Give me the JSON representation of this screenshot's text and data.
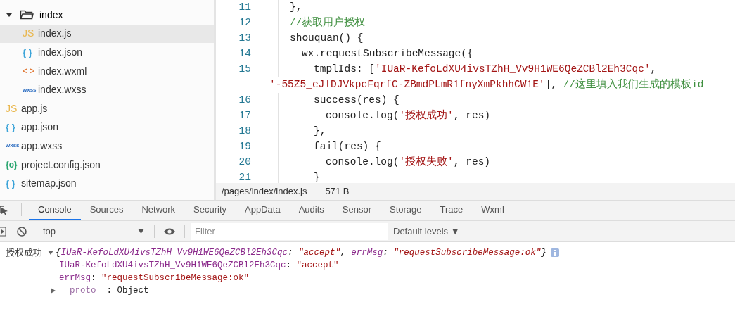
{
  "file_tree": [
    {
      "name": "index",
      "kind": "folder",
      "expanded": true,
      "selected": false,
      "children": [
        {
          "name": "index.js",
          "kind": "js",
          "icon": "JS",
          "selected": true
        },
        {
          "name": "index.json",
          "kind": "json",
          "icon": "{ }",
          "selected": false
        },
        {
          "name": "index.wxml",
          "kind": "wxml",
          "icon": "< >",
          "selected": false
        },
        {
          "name": "index.wxss",
          "kind": "wxss",
          "icon": "wxss",
          "selected": false
        }
      ]
    },
    {
      "name": "app.js",
      "kind": "js",
      "icon": "JS",
      "selected": false
    },
    {
      "name": "app.json",
      "kind": "json",
      "icon": "{ }",
      "selected": false
    },
    {
      "name": "app.wxss",
      "kind": "wxss",
      "icon": "wxss",
      "selected": false
    },
    {
      "name": "project.config.json",
      "kind": "config",
      "icon": "{o}",
      "selected": false
    },
    {
      "name": "sitemap.json",
      "kind": "json",
      "icon": "{ }",
      "selected": false
    }
  ],
  "editor": {
    "lines": [
      {
        "number": "11",
        "segments": [
          {
            "kind": "plain",
            "text": "    },"
          }
        ]
      },
      {
        "number": "12",
        "segments": [
          {
            "kind": "comment",
            "text": "    //获取用户授权"
          }
        ]
      },
      {
        "number": "13",
        "segments": [
          {
            "kind": "plain",
            "text": "    shouquan() {"
          }
        ]
      },
      {
        "number": "14",
        "segments": [
          {
            "kind": "plain",
            "text": "      wx.requestSubscribeMessage({"
          }
        ]
      },
      {
        "number": "15",
        "segments": [
          {
            "kind": "plain",
            "text": "        tmplIds: ["
          },
          {
            "kind": "string",
            "text": "'IUaR-KefoLdXU4ivsTZhH_Vv9H1WE6QeZCBl2Eh3Cqc'"
          },
          {
            "kind": "plain",
            "text": ","
          }
        ]
      },
      {
        "segments": [
          {
            "kind": "string",
            "text": "'-55Z5_eJlDJVkpcFqrfC-ZBmdPLmR1fnyXmPkhhCW1E'"
          },
          {
            "kind": "plain",
            "text": "], "
          },
          {
            "kind": "comment",
            "text": "//这里填入我们生成的模板id"
          }
        ]
      },
      {
        "number": "16",
        "segments": [
          {
            "kind": "plain",
            "text": "        success(res) {"
          }
        ]
      },
      {
        "number": "17",
        "segments": [
          {
            "kind": "plain",
            "text": "          console.log("
          },
          {
            "kind": "string",
            "text": "'授权成功'"
          },
          {
            "kind": "plain",
            "text": ", res)"
          }
        ]
      },
      {
        "number": "18",
        "segments": [
          {
            "kind": "plain",
            "text": "        },"
          }
        ]
      },
      {
        "number": "19",
        "segments": [
          {
            "kind": "plain",
            "text": "        fail(res) {"
          }
        ]
      },
      {
        "number": "20",
        "segments": [
          {
            "kind": "plain",
            "text": "          console.log("
          },
          {
            "kind": "string",
            "text": "'授权失败'"
          },
          {
            "kind": "plain",
            "text": ", res)"
          }
        ]
      },
      {
        "number": "21",
        "segments": [
          {
            "kind": "plain",
            "text": "        }"
          }
        ]
      }
    ],
    "status_bar": {
      "path": "/pages/index/index.js",
      "size": "571 B"
    }
  },
  "devtools": {
    "tabs": [
      {
        "label": "Console",
        "selected": true
      },
      {
        "label": "Sources",
        "selected": false
      },
      {
        "label": "Network",
        "selected": false
      },
      {
        "label": "Security",
        "selected": false
      },
      {
        "label": "AppData",
        "selected": false
      },
      {
        "label": "Audits",
        "selected": false
      },
      {
        "label": "Sensor",
        "selected": false
      },
      {
        "label": "Storage",
        "selected": false
      },
      {
        "label": "Trace",
        "selected": false
      },
      {
        "label": "Wxml",
        "selected": false
      }
    ],
    "context": "top",
    "filter_placeholder": "Filter",
    "levels": "Default levels ▼",
    "console": {
      "label": "授权成功",
      "summary": [
        {
          "kind": "punct",
          "text": "{"
        },
        {
          "kind": "key",
          "text": "IUaR-KefoLdXU4ivsTZhH_Vv9H1WE6QeZCBl2Eh3Cqc"
        },
        {
          "kind": "punct",
          "text": ": "
        },
        {
          "kind": "string",
          "text": "\"accept\""
        },
        {
          "kind": "punct",
          "text": ", "
        },
        {
          "kind": "key",
          "text": "errMsg"
        },
        {
          "kind": "punct",
          "text": ": "
        },
        {
          "kind": "string",
          "text": "\"requestSubscribeMessage:ok\""
        },
        {
          "kind": "punct",
          "text": "}"
        }
      ],
      "expanded": true,
      "properties": [
        {
          "kind": "value",
          "segments": [
            {
              "kind": "key",
              "text": "IUaR-KefoLdXU4ivsTZhH_Vv9H1WE6QeZCBl2Eh3Cqc"
            },
            {
              "kind": "punct",
              "text": ": "
            },
            {
              "kind": "string",
              "text": "\"accept\""
            }
          ]
        },
        {
          "kind": "value",
          "segments": [
            {
              "kind": "key",
              "text": "errMsg"
            },
            {
              "kind": "punct",
              "text": ": "
            },
            {
              "kind": "string",
              "text": "\"requestSubscribeMessage:ok\""
            }
          ]
        },
        {
          "kind": "object",
          "segments": [
            {
              "kind": "proto",
              "text": "__proto__"
            },
            {
              "kind": "punct",
              "text": ": "
            },
            {
              "kind": "punct",
              "text": "Object"
            }
          ]
        }
      ]
    }
  }
}
